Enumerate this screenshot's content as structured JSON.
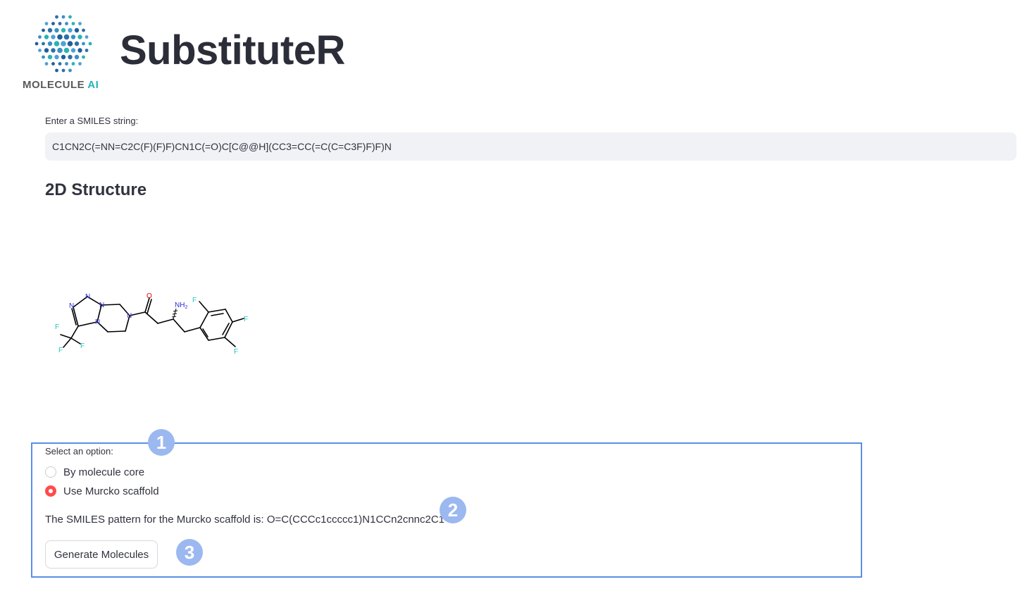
{
  "logo": {
    "text_main": "MOLECULE",
    "text_accent": "AI"
  },
  "app_title": "SubstituteR",
  "smiles_input": {
    "label": "Enter a SMILES string:",
    "value": "C1CN2C(=NN=C2C(F)(F)F)CN1C(=O)C[C@@H](CC3=CC(=C(C=C3F)F)F)N"
  },
  "structure": {
    "title": "2D Structure",
    "atom_labels": {
      "oxygen": "O",
      "amine": "NH",
      "amine_sub": "2",
      "nitrogen": "N",
      "fluorine": "F"
    }
  },
  "options": {
    "label": "Select an option:",
    "items": [
      {
        "label": "By molecule core",
        "selected": false
      },
      {
        "label": "Use Murcko scaffold",
        "selected": true
      }
    ]
  },
  "scaffold_text": "The SMILES pattern for the Murcko scaffold is: O=C(CCCc1ccccc1)N1CCn2cnnc2C1",
  "generate_button": "Generate Molecules",
  "badges": [
    "1",
    "2",
    "3"
  ],
  "colors": {
    "accent": "#ff4b4b",
    "highlight_border": "#5a8ee6",
    "badge": "#9bb8f0",
    "input_bg": "#f0f2f6",
    "nitrogen": "#2b2bd6",
    "oxygen": "#e00000",
    "fluorine": "#22c4c4"
  }
}
